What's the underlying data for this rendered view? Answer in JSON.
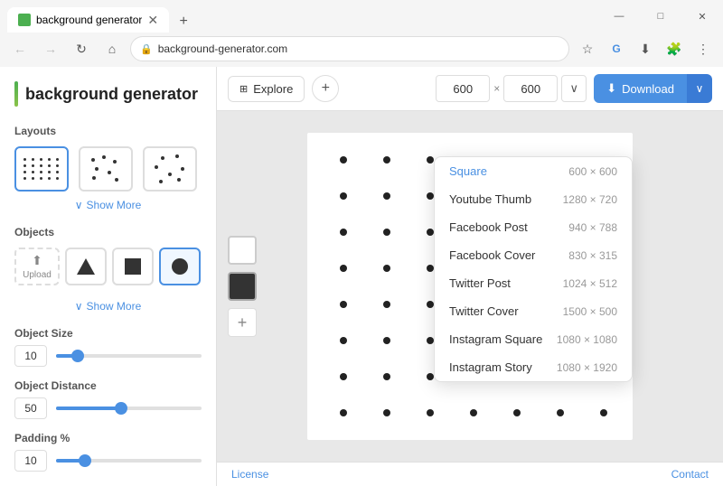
{
  "browser": {
    "tab_title": "background generator",
    "url": "background-generator.com",
    "new_tab_symbol": "+",
    "nav": {
      "back": "←",
      "forward": "→",
      "refresh": "↻",
      "home": "⌂"
    }
  },
  "window_controls": {
    "minimize": "—",
    "maximize": "□",
    "close": "✕"
  },
  "app": {
    "logo_text": "background generator",
    "sidebar": {
      "layouts_title": "Layouts",
      "show_more_1": "Show More",
      "objects_title": "Objects",
      "upload_label": "Upload",
      "show_more_2": "Show More",
      "object_size_title": "Object Size",
      "object_size_value": "10",
      "object_distance_title": "Object Distance",
      "object_distance_value": "50",
      "padding_title": "Padding %",
      "padding_value": "10"
    },
    "toolbar": {
      "explore_label": "Explore",
      "add_symbol": "+",
      "dim_width": "600",
      "dim_height": "600",
      "dim_separator": "×",
      "download_label": "Download",
      "download_icon": "⬇"
    },
    "dropdown": {
      "items": [
        {
          "label": "Square",
          "dims": "600 × 600",
          "active": true
        },
        {
          "label": "Youtube Thumb",
          "dims": "1280 × 720",
          "active": false
        },
        {
          "label": "Facebook Post",
          "dims": "940 × 788",
          "active": false
        },
        {
          "label": "Facebook Cover",
          "dims": "830 × 315",
          "active": false
        },
        {
          "label": "Twitter Post",
          "dims": "1024 × 512",
          "active": false
        },
        {
          "label": "Twitter Cover",
          "dims": "1500 × 500",
          "active": false
        },
        {
          "label": "Instagram Square",
          "dims": "1080 × 1080",
          "active": false
        },
        {
          "label": "Instagram Story",
          "dims": "1080 × 1920",
          "active": false
        }
      ]
    },
    "footer": {
      "license": "License",
      "contact": "Contact"
    }
  }
}
